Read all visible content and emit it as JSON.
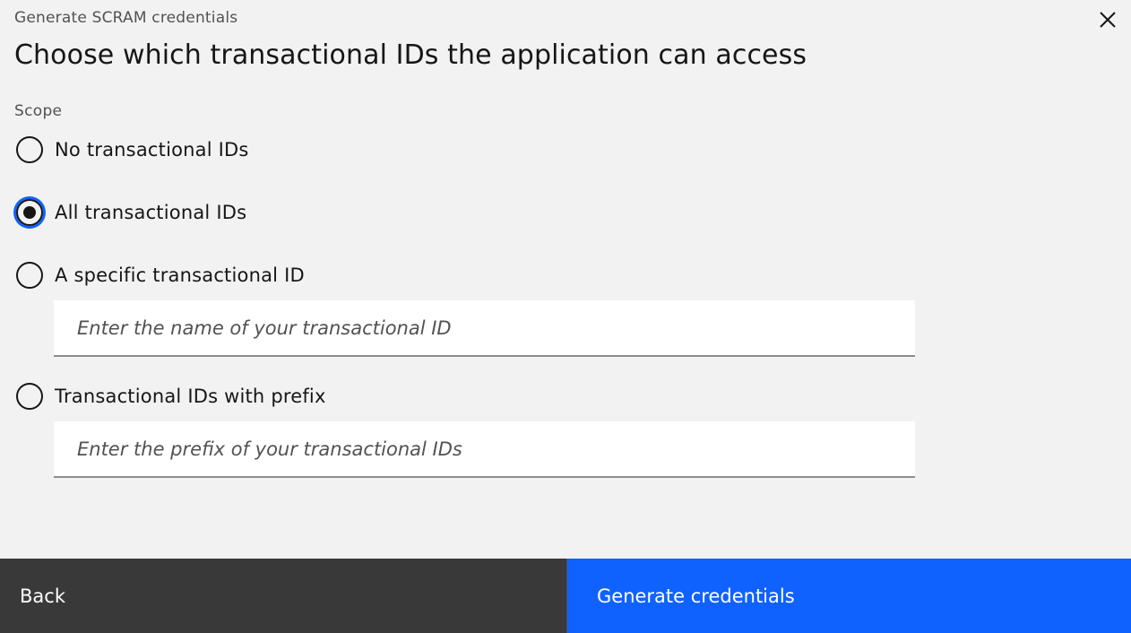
{
  "header": {
    "label": "Generate SCRAM credentials",
    "title": "Choose which transactional IDs the application can access",
    "close_icon": "close-icon"
  },
  "scope": {
    "label": "Scope",
    "selected": "all",
    "options": [
      {
        "id": "none",
        "label": "No transactional IDs"
      },
      {
        "id": "all",
        "label": "All transactional IDs"
      },
      {
        "id": "specific",
        "label": "A specific transactional ID"
      },
      {
        "id": "prefix",
        "label": "Transactional IDs with prefix"
      }
    ],
    "specific_input": {
      "value": "",
      "placeholder": "Enter the name of your transactional ID"
    },
    "prefix_input": {
      "value": "",
      "placeholder": "Enter the prefix of your transactional IDs"
    }
  },
  "footer": {
    "back_label": "Back",
    "generate_label": "Generate credentials"
  },
  "colors": {
    "background": "#f2f2f2",
    "primary": "#0f62fe",
    "secondary": "#393939",
    "text": "#161616"
  }
}
